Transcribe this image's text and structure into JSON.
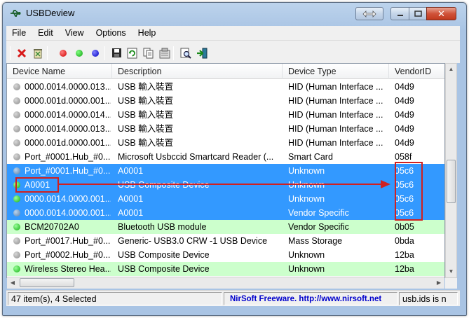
{
  "window": {
    "title": "USBDeview"
  },
  "menu": [
    "File",
    "Edit",
    "View",
    "Options",
    "Help"
  ],
  "toolbar": {
    "icons": [
      "disconnect-icon",
      "uninstall-icon",
      "red-dot-icon",
      "green-dot-icon",
      "blue-dot-icon",
      "save-icon",
      "refresh-icon",
      "copy-icon",
      "properties-icon",
      "find-icon",
      "exit-icon"
    ]
  },
  "columns": [
    "Device Name",
    "Description",
    "Device Type",
    "VendorID"
  ],
  "rows": [
    {
      "name": "0000.0014.0000.013....",
      "description": "USB 輸入裝置",
      "type": "HID (Human Interface ...",
      "vendor": "04d9",
      "status": "gray",
      "state": "normal"
    },
    {
      "name": "0000.001d.0000.001...",
      "description": "USB 輸入裝置",
      "type": "HID (Human Interface ...",
      "vendor": "04d9",
      "status": "gray",
      "state": "normal"
    },
    {
      "name": "0000.0014.0000.014....",
      "description": "USB 輸入裝置",
      "type": "HID (Human Interface ...",
      "vendor": "04d9",
      "status": "gray",
      "state": "normal"
    },
    {
      "name": "0000.0014.0000.013....",
      "description": "USB 輸入裝置",
      "type": "HID (Human Interface ...",
      "vendor": "04d9",
      "status": "gray",
      "state": "normal"
    },
    {
      "name": "0000.001d.0000.001...",
      "description": "USB 輸入裝置",
      "type": "HID (Human Interface ...",
      "vendor": "04d9",
      "status": "gray",
      "state": "normal"
    },
    {
      "name": "Port_#0001.Hub_#0...",
      "description": "Microsoft Usbccid Smartcard Reader (...",
      "type": "Smart Card",
      "vendor": "058f",
      "status": "gray",
      "state": "normal"
    },
    {
      "name": "Port_#0001.Hub_#0...",
      "description": "A0001",
      "type": "Unknown",
      "vendor": "05c6",
      "status": "gray",
      "state": "selected"
    },
    {
      "name": "A0001",
      "description": "USB Composite Device",
      "type": "Unknown",
      "vendor": "05c6",
      "status": "green",
      "state": "selected"
    },
    {
      "name": "0000.0014.0000.001....",
      "description": "A0001",
      "type": "Unknown",
      "vendor": "05c6",
      "status": "green",
      "state": "selected"
    },
    {
      "name": "0000.0014.0000.001....",
      "description": "A0001",
      "type": "Vendor Specific",
      "vendor": "05c6",
      "status": "gray",
      "state": "selected"
    },
    {
      "name": "BCM20702A0",
      "description": "Bluetooth USB module",
      "type": "Vendor Specific",
      "vendor": "0b05",
      "status": "green",
      "state": "connected"
    },
    {
      "name": "Port_#0017.Hub_#0...",
      "description": "Generic- USB3.0 CRW   -1 USB Device",
      "type": "Mass Storage",
      "vendor": "0bda",
      "status": "gray",
      "state": "normal"
    },
    {
      "name": "Port_#0002.Hub_#0...",
      "description": "USB Composite Device",
      "type": "Unknown",
      "vendor": "12ba",
      "status": "gray",
      "state": "normal"
    },
    {
      "name": "Wireless Stereo Hea...",
      "description": "USB Composite Device",
      "type": "Unknown",
      "vendor": "12ba",
      "status": "green",
      "state": "connected"
    }
  ],
  "statusbar": {
    "count": "47 item(s), 4 Selected",
    "link": "NirSoft Freeware.  http://www.nirsoft.net",
    "ids": "usb.ids is n"
  },
  "colors": {
    "selected": "#3399ff",
    "connected": "#ccffcc",
    "annotation": "#d02020"
  }
}
